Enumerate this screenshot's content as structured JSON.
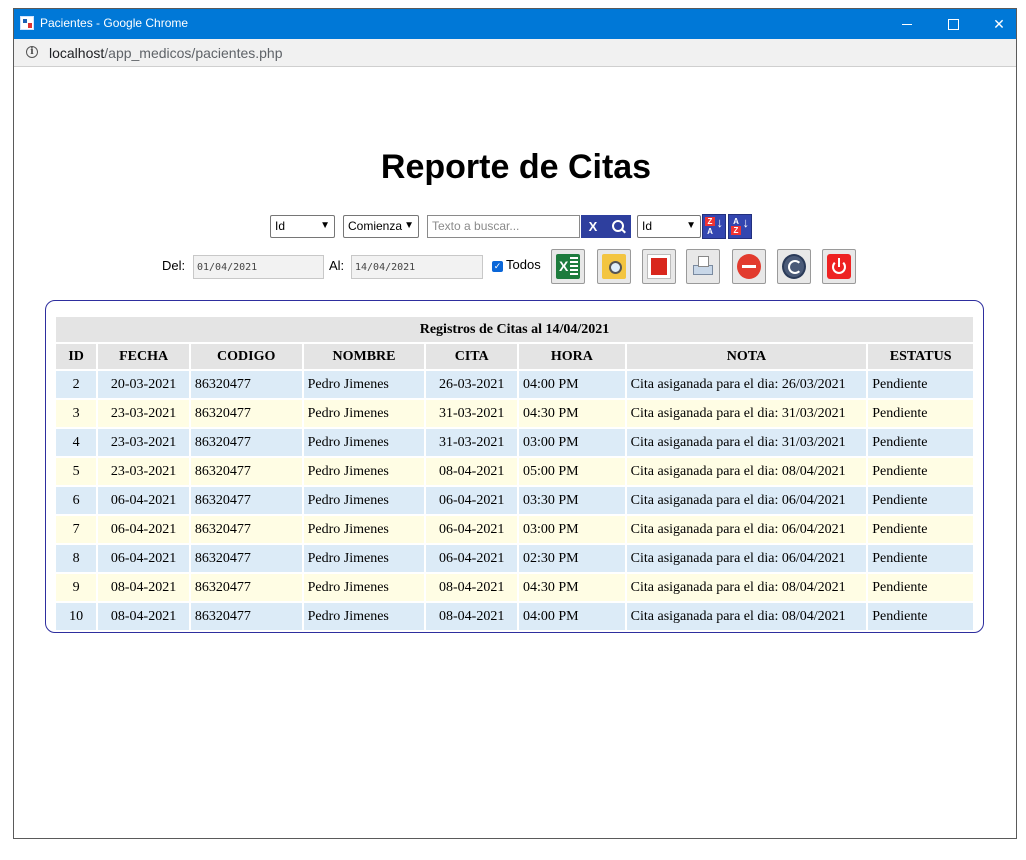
{
  "window": {
    "title": "Pacientes - Google Chrome",
    "url_host": "localhost",
    "url_path": "/app_medicos/pacientes.php"
  },
  "page": {
    "title": "Reporte de Citas"
  },
  "filters": {
    "field_select": "Id",
    "mode_select": "Comienza",
    "search_placeholder": "Texto a buscar...",
    "clear_label": "X",
    "sort_select": "Id",
    "sort_asc_label": "A Z",
    "sort_desc_label": "Z A",
    "del_label": "Del:",
    "del_value": "01/04/2021",
    "al_label": "Al:",
    "al_value": "14/04/2021",
    "todos_label": "Todos",
    "todos_checked": true
  },
  "toolbar": [
    "excel-icon",
    "folder-search-icon",
    "pdf-icon",
    "printer-icon",
    "cancel-icon",
    "refresh-icon",
    "power-icon"
  ],
  "report": {
    "caption": "Registros de Citas al 14/04/2021",
    "columns": [
      "ID",
      "FECHA",
      "CODIGO",
      "NOMBRE",
      "CITA",
      "HORA",
      "NOTA",
      "ESTATUS"
    ],
    "rows": [
      [
        "2",
        "20-03-2021",
        "86320477",
        "Pedro Jimenes",
        "26-03-2021",
        "04:00 PM",
        "Cita asiganada para el dia: 26/03/2021",
        "Pendiente"
      ],
      [
        "3",
        "23-03-2021",
        "86320477",
        "Pedro Jimenes",
        "31-03-2021",
        "04:30 PM",
        "Cita asiganada para el dia: 31/03/2021",
        "Pendiente"
      ],
      [
        "4",
        "23-03-2021",
        "86320477",
        "Pedro Jimenes",
        "31-03-2021",
        "03:00 PM",
        "Cita asiganada para el dia: 31/03/2021",
        "Pendiente"
      ],
      [
        "5",
        "23-03-2021",
        "86320477",
        "Pedro Jimenes",
        "08-04-2021",
        "05:00 PM",
        "Cita asiganada para el dia: 08/04/2021",
        "Pendiente"
      ],
      [
        "6",
        "06-04-2021",
        "86320477",
        "Pedro Jimenes",
        "06-04-2021",
        "03:30 PM",
        "Cita asiganada para el dia: 06/04/2021",
        "Pendiente"
      ],
      [
        "7",
        "06-04-2021",
        "86320477",
        "Pedro Jimenes",
        "06-04-2021",
        "03:00 PM",
        "Cita asiganada para el dia: 06/04/2021",
        "Pendiente"
      ],
      [
        "8",
        "06-04-2021",
        "86320477",
        "Pedro Jimenes",
        "06-04-2021",
        "02:30 PM",
        "Cita asiganada para el dia: 06/04/2021",
        "Pendiente"
      ],
      [
        "9",
        "08-04-2021",
        "86320477",
        "Pedro Jimenes",
        "08-04-2021",
        "04:30 PM",
        "Cita asiganada para el dia: 08/04/2021",
        "Pendiente"
      ],
      [
        "10",
        "08-04-2021",
        "86320477",
        "Pedro Jimenes",
        "08-04-2021",
        "04:00 PM",
        "Cita asiganada para el dia: 08/04/2021",
        "Pendiente"
      ]
    ]
  },
  "colors": {
    "titlebar": "#0078d7",
    "button_blue": "#2e3f9e",
    "row_blue": "#dcebf7",
    "row_yellow": "#fffde4",
    "header_gray": "#e4e4e4"
  }
}
